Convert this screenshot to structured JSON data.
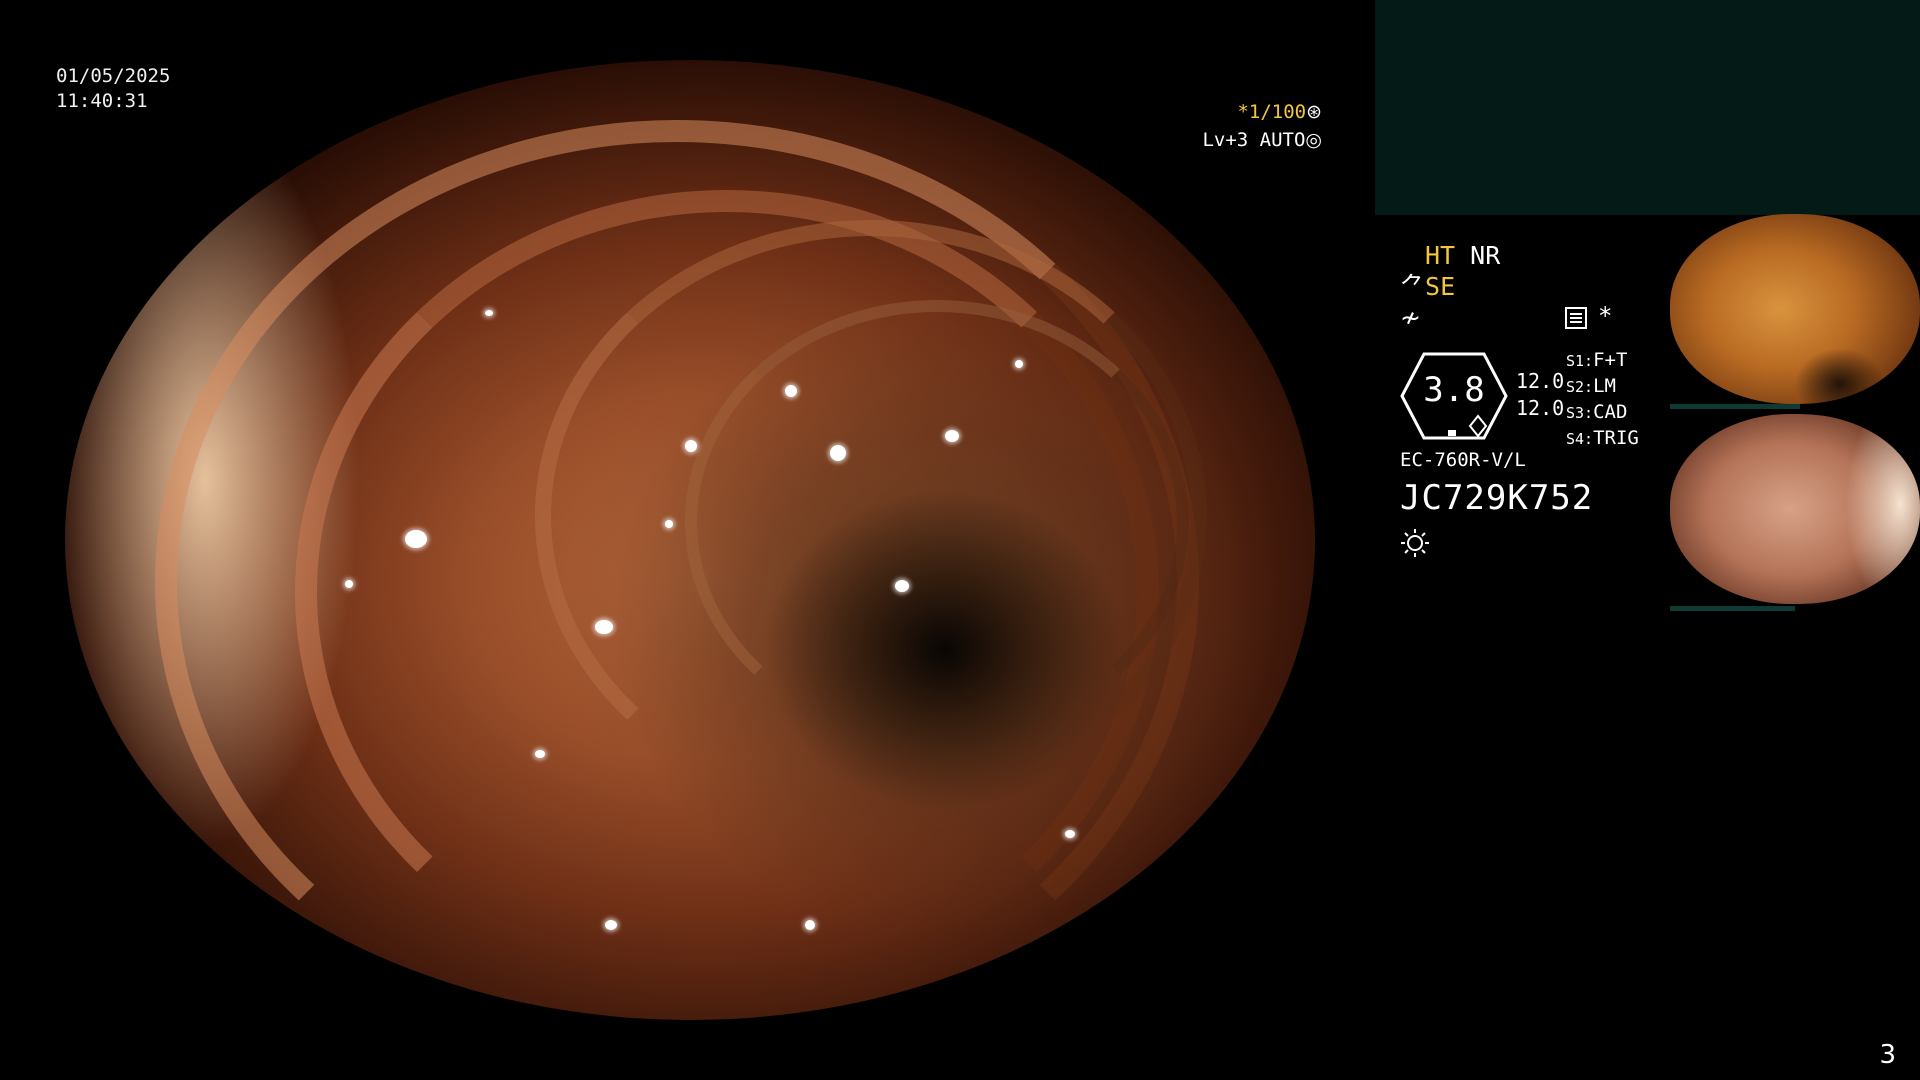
{
  "osd": {
    "date": "01/05/2025",
    "time": "11:40:31",
    "shutter": "*1/100",
    "iris": "Lv+3 AUTO",
    "mode_ht": "HT",
    "mode_nr": "NR",
    "mode_se": "SE",
    "zoom": "3.8",
    "gain1": "12.0",
    "gain2": "12.0",
    "slots": [
      {
        "key": "S1:",
        "value": "F+T"
      },
      {
        "key": "S2:",
        "value": "LM"
      },
      {
        "key": "S3:",
        "value": "CAD"
      },
      {
        "key": "S4:",
        "value": "TRIG"
      }
    ],
    "scope_model": "EC-760R-V/L",
    "serial": "JC729K752",
    "star": "*",
    "page": "3"
  },
  "colors": {
    "accent_yellow": "#f2c542",
    "panel_teal": "#041a16",
    "text": "#ffffff"
  },
  "icons": [
    "shutter-mode-icon",
    "iris-mode-icon",
    "scope-tilde-icon",
    "freeze-icon",
    "memo-icon",
    "light-source-icon"
  ]
}
